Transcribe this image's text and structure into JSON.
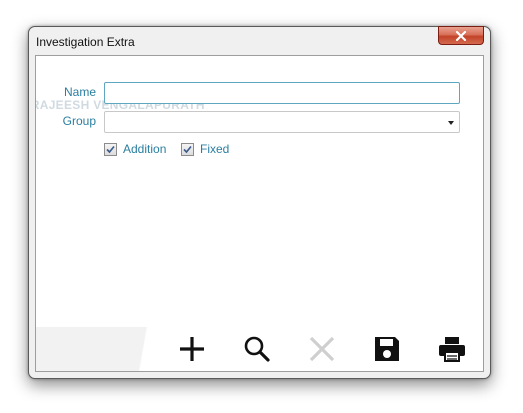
{
  "window": {
    "title": "Investigation Extra"
  },
  "form": {
    "name_label": "Name",
    "name_value": "",
    "group_label": "Group",
    "group_value": ""
  },
  "checkboxes": [
    {
      "label": "Addition",
      "checked": true
    },
    {
      "label": "Fixed",
      "checked": true
    }
  ],
  "watermark": "© RAJEESH VENGALAPURATH",
  "toolbar": {
    "icons": [
      "add-icon",
      "search-icon",
      "delete-icon",
      "save-icon",
      "print-icon"
    ],
    "delete_disabled": true
  },
  "colors": {
    "label_text": "#2a7fa0",
    "input_border": "#5fa6c1",
    "close_button": "#c24328",
    "icon": "#111111",
    "icon_disabled": "#cfcfcf"
  }
}
